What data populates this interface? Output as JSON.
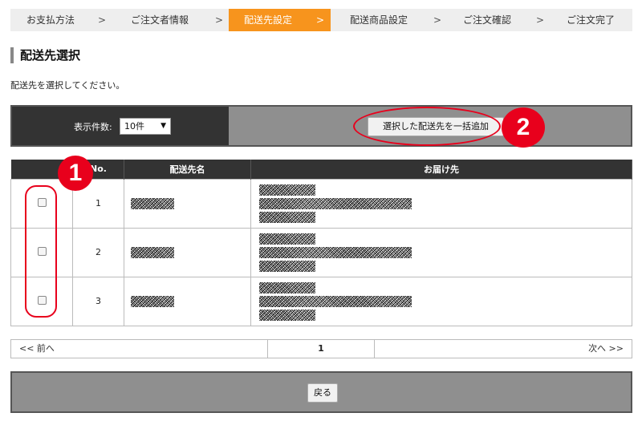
{
  "steps": [
    {
      "label": "お支払方法",
      "active": false
    },
    {
      "label": "ご注文者情報",
      "active": false
    },
    {
      "label": "配送先設定",
      "active": true
    },
    {
      "label": "配送商品設定",
      "active": false
    },
    {
      "label": "ご注文確認",
      "active": false
    },
    {
      "label": "ご注文完了",
      "active": false
    }
  ],
  "step_separator": ">",
  "heading": "配送先選択",
  "instruction": "配送先を選択してください。",
  "controls": {
    "per_page_label": "表示件数:",
    "per_page_value": "10件",
    "bulk_add_button": "選択した配送先を一括追加"
  },
  "table": {
    "headers": [
      "No.",
      "配送先名",
      "お届け先"
    ],
    "rows": [
      {
        "no": "1",
        "checked": false
      },
      {
        "no": "2",
        "checked": false
      },
      {
        "no": "3",
        "checked": false
      }
    ]
  },
  "pagination": {
    "prev": "<< 前へ",
    "current": "1",
    "next": "次へ >>"
  },
  "back_button": "戻る",
  "annotations": {
    "marker_1": "1",
    "marker_2": "2",
    "color": "#e8001c"
  },
  "colors": {
    "active_step": "#f7941d",
    "dark_bar": "#333333",
    "gray_bar": "#8f8f8f"
  }
}
